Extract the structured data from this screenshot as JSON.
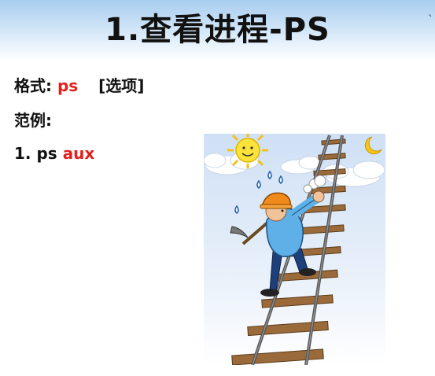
{
  "slide": {
    "title": "1.查看进程-PS",
    "stray_glyph": "`"
  },
  "content": {
    "format_label": "格式:",
    "format_command": "ps",
    "format_options": "[选项]",
    "example_label": "范例:",
    "example_number": "1.",
    "example_command": "ps",
    "example_args": "aux"
  },
  "colors": {
    "accent_red": "#e3201b",
    "header_blue": "#a7cdef"
  },
  "illustration": {
    "subject": "worker-climbing-railway-ladder-clipart"
  }
}
